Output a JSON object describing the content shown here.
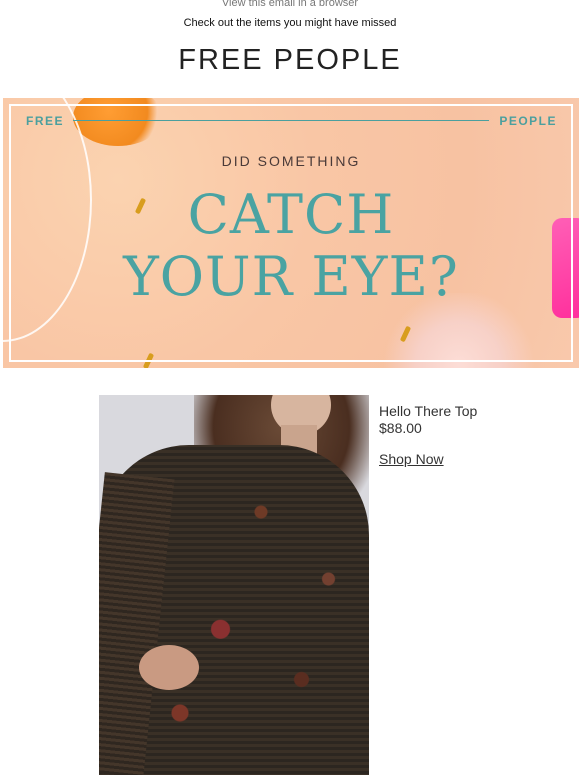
{
  "header": {
    "browser_link": "View this email in a browser",
    "preheader": "Check out the items you might have missed",
    "logo": "FREE PEOPLE"
  },
  "banner": {
    "brand_left": "FREE",
    "brand_right": "PEOPLE",
    "kicker": "DID SOMETHING",
    "headline_line1": "CATCH",
    "headline_line2": "YOUR EYE?",
    "colors": {
      "background": "#f9c6a5",
      "accent": "#4aa3a2",
      "frame": "#ffffff"
    }
  },
  "product": {
    "name": "Hello There Top",
    "price": "$88.00",
    "cta": "Shop Now"
  }
}
